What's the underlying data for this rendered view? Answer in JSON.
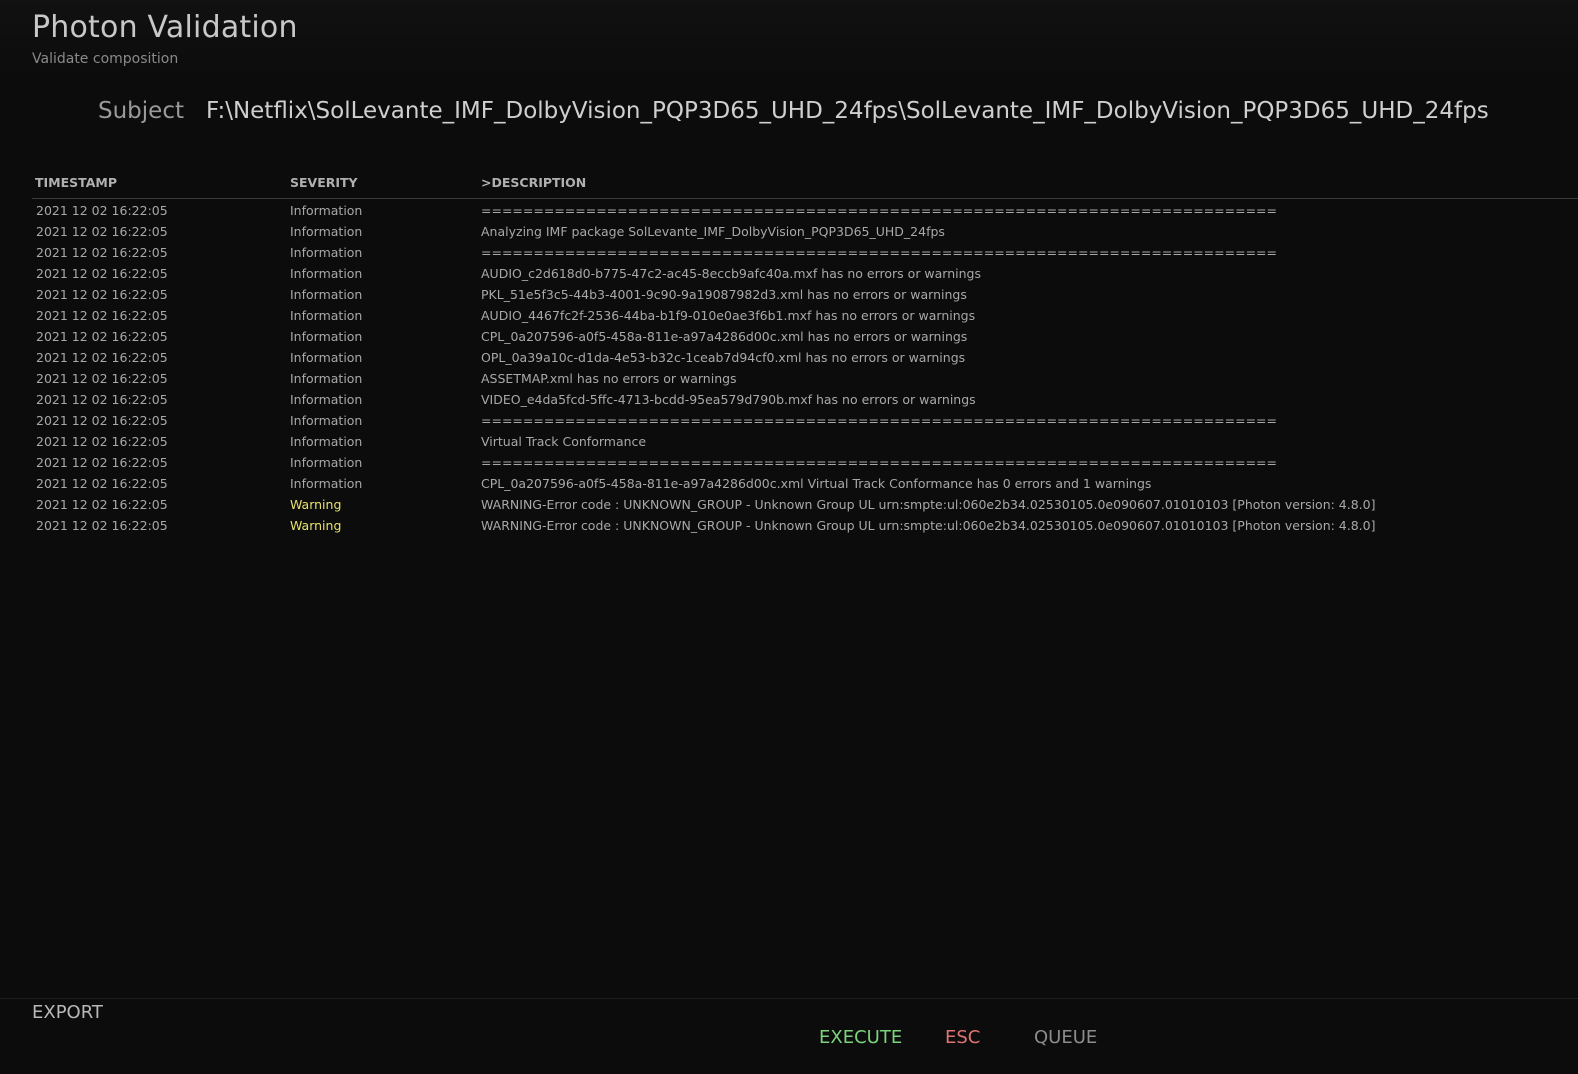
{
  "header": {
    "title": "Photon Validation",
    "subtitle": "Validate composition"
  },
  "subject": {
    "label": "Subject",
    "value": "F:\\Netflix\\SolLevante_IMF_DolbyVision_PQP3D65_UHD_24fps\\SolLevante_IMF_DolbyVision_PQP3D65_UHD_24fps"
  },
  "log": {
    "columns": {
      "timestamp": "TIMESTAMP",
      "severity": "SEVERITY",
      "description": ">DESCRIPTION"
    },
    "rows": [
      {
        "timestamp": "2021 12 02 16:22:05",
        "severity": "Information",
        "description": "============================================================================"
      },
      {
        "timestamp": "2021 12 02 16:22:05",
        "severity": "Information",
        "description": "Analyzing IMF package SolLevante_IMF_DolbyVision_PQP3D65_UHD_24fps"
      },
      {
        "timestamp": "2021 12 02 16:22:05",
        "severity": "Information",
        "description": "============================================================================"
      },
      {
        "timestamp": "2021 12 02 16:22:05",
        "severity": "Information",
        "description": "AUDIO_c2d618d0-b775-47c2-ac45-8eccb9afc40a.mxf has no errors or warnings"
      },
      {
        "timestamp": "2021 12 02 16:22:05",
        "severity": "Information",
        "description": "PKL_51e5f3c5-44b3-4001-9c90-9a19087982d3.xml has no errors or warnings"
      },
      {
        "timestamp": "2021 12 02 16:22:05",
        "severity": "Information",
        "description": "AUDIO_4467fc2f-2536-44ba-b1f9-010e0ae3f6b1.mxf has no errors or warnings"
      },
      {
        "timestamp": "2021 12 02 16:22:05",
        "severity": "Information",
        "description": "CPL_0a207596-a0f5-458a-811e-a97a4286d00c.xml has no errors or warnings"
      },
      {
        "timestamp": "2021 12 02 16:22:05",
        "severity": "Information",
        "description": "OPL_0a39a10c-d1da-4e53-b32c-1ceab7d94cf0.xml has no errors or warnings"
      },
      {
        "timestamp": "2021 12 02 16:22:05",
        "severity": "Information",
        "description": "ASSETMAP.xml has no errors or warnings"
      },
      {
        "timestamp": "2021 12 02 16:22:05",
        "severity": "Information",
        "description": "VIDEO_e4da5fcd-5ffc-4713-bcdd-95ea579d790b.mxf has no errors or warnings"
      },
      {
        "timestamp": "2021 12 02 16:22:05",
        "severity": "Information",
        "description": "============================================================================"
      },
      {
        "timestamp": "2021 12 02 16:22:05",
        "severity": "Information",
        "description": "Virtual Track Conformance"
      },
      {
        "timestamp": "2021 12 02 16:22:05",
        "severity": "Information",
        "description": "============================================================================"
      },
      {
        "timestamp": "2021 12 02 16:22:05",
        "severity": "Information",
        "description": "CPL_0a207596-a0f5-458a-811e-a97a4286d00c.xml Virtual Track Conformance has 0 errors and 1 warnings"
      },
      {
        "timestamp": "2021 12 02 16:22:05",
        "severity": "Warning",
        "description": "WARNING-Error code : UNKNOWN_GROUP - Unknown Group UL urn:smpte:ul:060e2b34.02530105.0e090607.01010103 [Photon version: 4.8.0]"
      },
      {
        "timestamp": "2021 12 02 16:22:05",
        "severity": "Warning",
        "description": "WARNING-Error code : UNKNOWN_GROUP - Unknown Group UL urn:smpte:ul:060e2b34.02530105.0e090607.01010103 [Photon version: 4.8.0]"
      }
    ]
  },
  "footer": {
    "export_label": "EXPORT",
    "execute_label": "EXECUTE",
    "esc_label": "ESC",
    "queue_label": "QUEUE"
  },
  "colors": {
    "background": "#0c0c0c",
    "warning": "#e8e06a",
    "execute": "#7bd37b",
    "esc": "#e07474",
    "queue": "#8c8c8c"
  }
}
